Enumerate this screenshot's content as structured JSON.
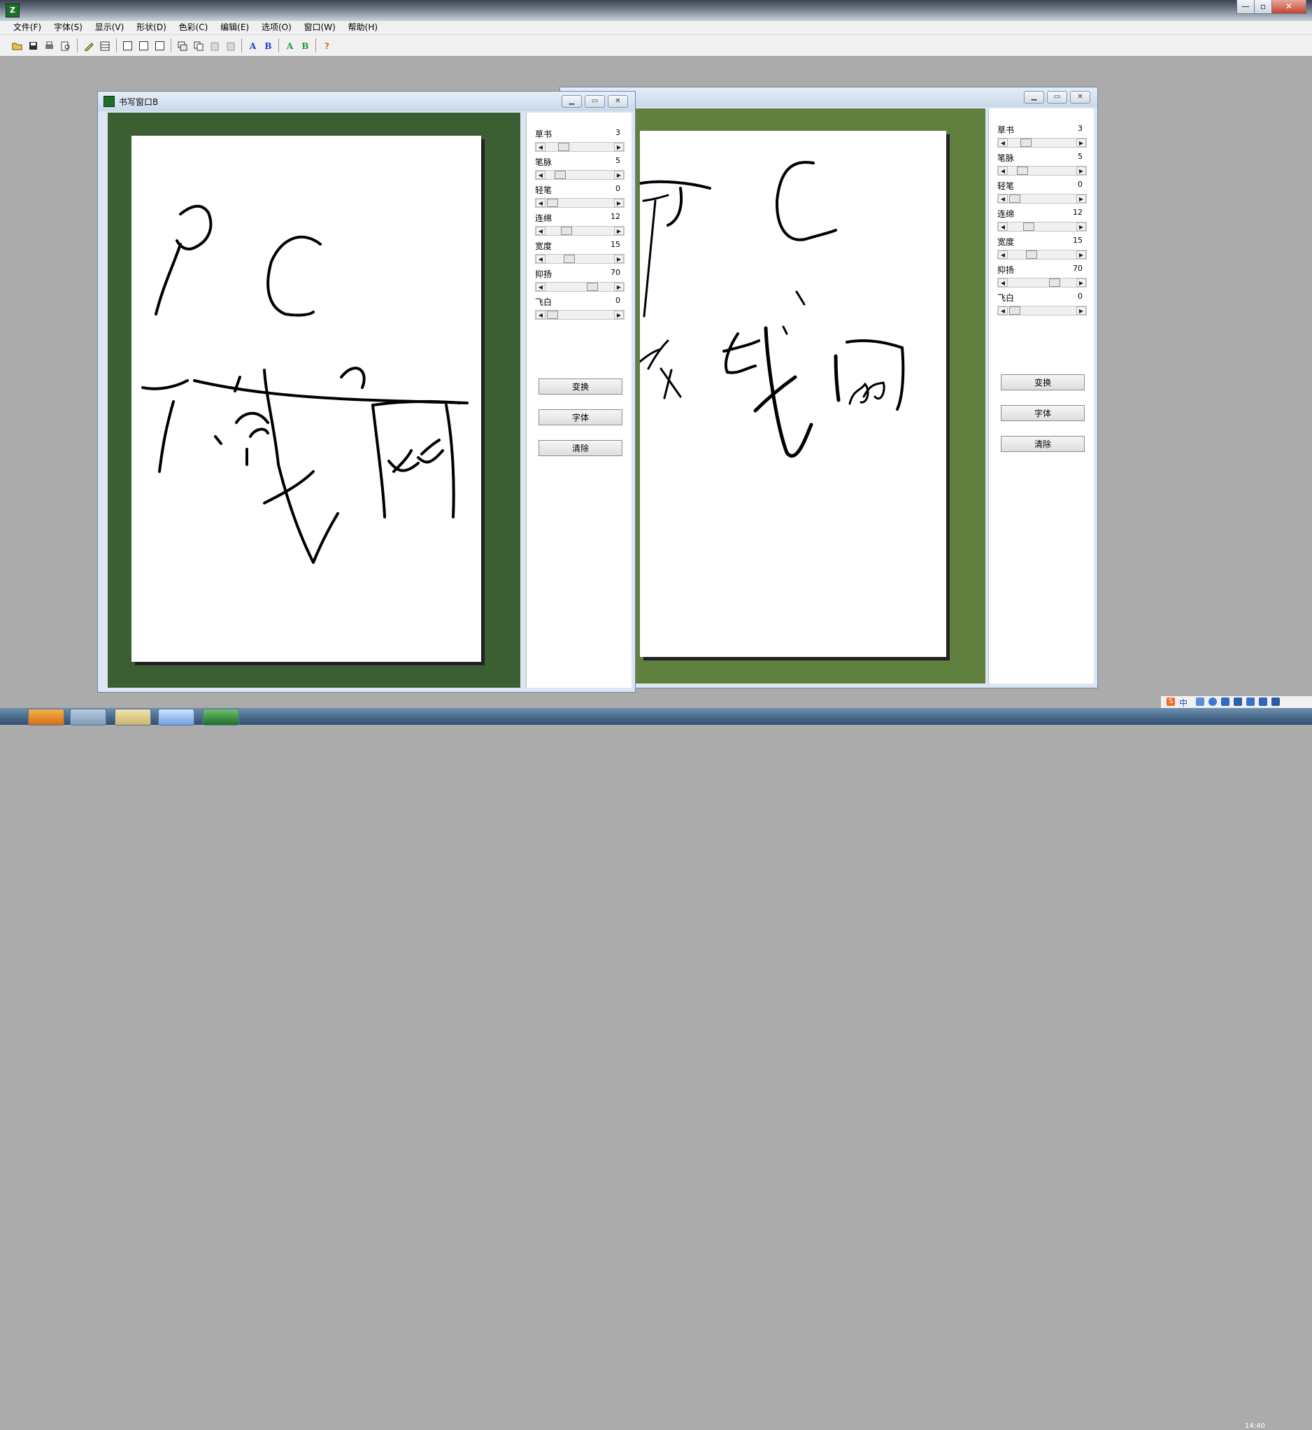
{
  "app": {
    "title_icon": "app-logo-icon",
    "caption_buttons": [
      "—",
      "▫",
      "✕"
    ]
  },
  "menu": [
    "文件(F)",
    "字体(S)",
    "显示(V)",
    "形状(D)",
    "色彩(C)",
    "编辑(E)",
    "选项(O)",
    "窗口(W)",
    "帮助(H)"
  ],
  "toolbar": {
    "icons": [
      "open-folder-icon",
      "save-icon",
      "print-icon",
      "print-preview-icon",
      "pen-icon",
      "grid-icon",
      "single-page-icon",
      "page-icon",
      "page-icon",
      "cascade-windows-icon",
      "copy-icon",
      "paste-icon",
      "clipboard-icon"
    ],
    "text_a_blue": "A",
    "text_b_blue": "B",
    "text_a_green": "A",
    "text_b_green": "B",
    "help": "?"
  },
  "window_b": {
    "title": "书写窗口B",
    "canvas_color": "#3b5e33"
  },
  "window_a": {
    "title": "",
    "canvas_color": "#617f3e"
  },
  "sliders": [
    {
      "label": "草书",
      "value": "3",
      "level": 0.22
    },
    {
      "label": "笔脉",
      "value": "5",
      "level": 0.16
    },
    {
      "label": "轻笔",
      "value": "0",
      "level": 0.02
    },
    {
      "label": "连绵",
      "value": "12",
      "level": 0.26
    },
    {
      "label": "宽度",
      "value": "15",
      "level": 0.31
    },
    {
      "label": "抑扬",
      "value": "70",
      "level": 0.7
    },
    {
      "label": "飞白",
      "value": "0",
      "level": 0.02
    }
  ],
  "buttons": {
    "transform": "变换",
    "font": "字体",
    "clear": "清除"
  },
  "tray": {
    "ime": "中",
    "clock": "14:40"
  }
}
